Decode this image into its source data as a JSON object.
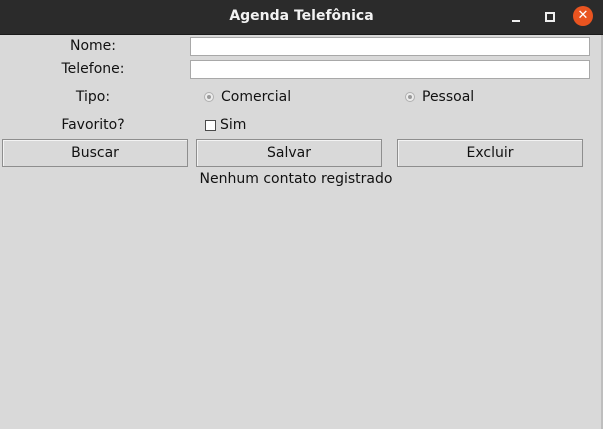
{
  "window": {
    "title": "Agenda Telefônica"
  },
  "form": {
    "nome_label": "Nome:",
    "nome_value": "",
    "telefone_label": "Telefone:",
    "telefone_value": "",
    "tipo_label": "Tipo:",
    "tipo_options": [
      "Comercial",
      "Pessoal"
    ],
    "favorito_label": "Favorito?",
    "favorito_option": "Sim"
  },
  "buttons": {
    "buscar": "Buscar",
    "salvar": "Salvar",
    "excluir": "Excluir"
  },
  "status": "Nenhum contato registrado",
  "colors": {
    "titlebar": "#2b2b2b",
    "background": "#d9d9d9",
    "close_button": "#e95420"
  }
}
